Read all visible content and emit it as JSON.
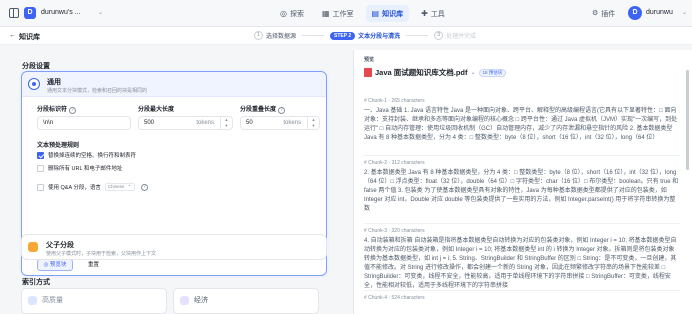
{
  "topbar": {
    "workspace_initial": "D",
    "workspace_name": "durunwu's ...",
    "nav": [
      {
        "label": "探索",
        "icon": "explore-icon"
      },
      {
        "label": "工作室",
        "icon": "studio-icon"
      },
      {
        "label": "知识库",
        "icon": "knowledge-icon",
        "active": true
      },
      {
        "label": "工具",
        "icon": "tools-icon"
      }
    ],
    "plugin_label": "插件",
    "user_initial": "D",
    "user_name": "durunwu"
  },
  "steps_bar": {
    "back_label": "知识库",
    "steps": [
      {
        "num": "1",
        "label": "选择数据源"
      },
      {
        "badge": "STEP 2",
        "label": "文本分段与清洗"
      },
      {
        "num": "3",
        "label": "处理并完成"
      }
    ]
  },
  "segment_settings": {
    "title": "分段设置",
    "general": {
      "title": "通用",
      "desc": "通用文本分块模式，检索和召回的块是相同的"
    },
    "delimiter": {
      "label": "分段标识符",
      "value": "\\n\\n"
    },
    "max_length": {
      "label": "分段最大长度",
      "value": "500",
      "unit": "tokens"
    },
    "overlap": {
      "label": "分段重叠长度",
      "value": "50",
      "unit": "tokens"
    },
    "preprocess_title": "文本预处理规则",
    "rules": [
      {
        "label": "替换掉连续的空格、换行符和制表符",
        "checked": true
      },
      {
        "label": "删除所有 URL 和电子邮件地址",
        "checked": false
      }
    ],
    "qa": {
      "label": "使用 Q&A 分段，语言",
      "lang": "Chinese"
    },
    "preview_button": "预览块",
    "reset_button": "重置",
    "parent": {
      "title": "父子分段",
      "desc": "使用父子模式时，子块用于检索，父块用作上下文"
    }
  },
  "index_method": {
    "title": "索引方式",
    "options": [
      "高质量",
      "经济"
    ]
  },
  "preview": {
    "label": "预览",
    "doc_title": "Java 面试题知识库文档.pdf",
    "chunk_count": "18 预估块",
    "chunks": [
      {
        "meta": "# Chunk-1 · 265 characters",
        "text": "一、Java 基础 1. Java 语言特性 Java 是一种面向对象、跨平台、解释型的高级编程语言(它具有以下显著特性：□ 面向对象：支持封装、继承和多态等面向对象编程的核心概念 □ 跨平台性：通过 Java 虚拟机（JVM）实现\"一次编写，到处运行\" □ 自动内存管理：使用垃圾回收机制（GC）自动管理内存，减少了内存泄漏和悬空指针的风险 2. 基本数据类型 Java 有 8 种基本数据类型，分为 4 类：□ 整数类型：byte（8 位），short（16 位），int（32 位），long（64 位）"
      },
      {
        "meta": "# Chunk-2 · 312 characters",
        "text": "2. 基本数据类型 Java 有 8 种基本数据类型，分为 4 类：□ 整数类型：byte（8 位），short（16 位），int（32 位），long（64 位）□ 浮点类型：float（32 位），double（64 位）□ 字符类型：char（16 位）□ 布尔类型：boolean。只有 true 和 false 两个值 3. 包装类 为了使基本数据类型具有对象的特性，Java 为每种基本数据类型都提供了对应的包装类，如 Integer 对应 int，Double 对应 double 等包装类提供了一些实用的方法，例如 Integer.parseInt() 用于将字符串转换为整数"
      },
      {
        "meta": "# Chunk-3 · 320 characters",
        "text": "4. 自动装箱和拆箱 自动装箱是指将基本数据类型自动转换为对应的包装类对象，例如 Integer i = 10; 将基本数据类型自动转换为对应的包装类对象，例如 Integer i = 10; 将基本数据类型 int 的 i 转换为 Integer 对象。拆箱则是将包装类对象转换为基本数据类型，如 int j = i; 5. String、StringBuilder 和 StringBuffer 的区别 □ String：是不可变类，一旦创建，其值不能修改。对 String 进行修改操作，都会创建一个新的 String 对象，因此在频繁修改字符串的场景下性能较差 □ StringBuilder：可变类，线程不安全，性能较高，适用于单线程环境下的字符串拼接 □ StringBuffer：可变类，线程安全，性能相对较低，适用于多线程环境下的字符串拼接"
      },
      {
        "meta": "# Chunk-4 · 524 characters",
        "text": ""
      }
    ]
  },
  "colors": {
    "accent": "#3d64f5",
    "accent_light": "#eef3ff",
    "pdf": "#e5484d",
    "parent": "#f7a733"
  }
}
